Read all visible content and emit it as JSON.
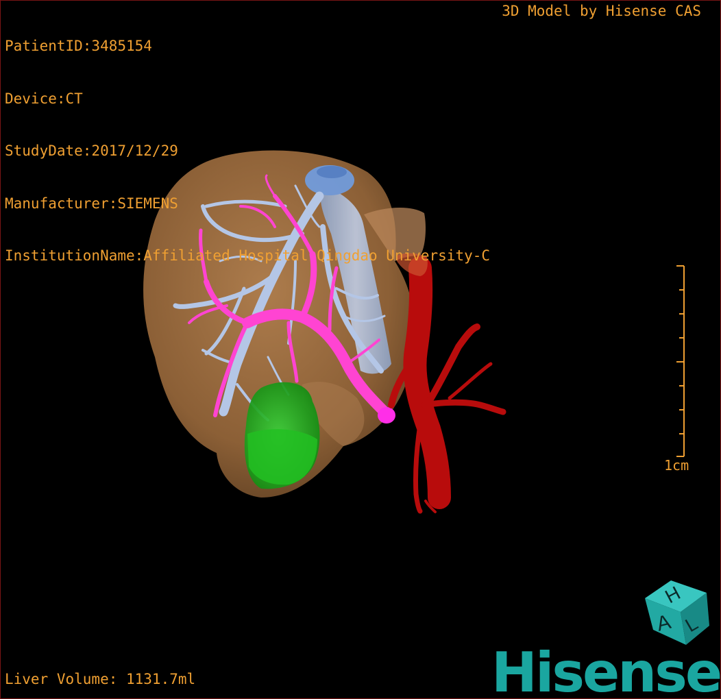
{
  "viewer": {
    "info": {
      "patient_id": "PatientID:3485154",
      "device": "Device:CT",
      "study_date": "StudyDate:2017/12/29",
      "manufacturer": "Manufacturer:SIEMENS",
      "institution": "InstitutionName:Affiliated Hospital Qingdao University-C"
    },
    "model_credit": "3D Model by Hisense CAS",
    "liver_volume": "Liver Volume: 1131.7ml",
    "scale_label": "1cm",
    "orientation_cube": {
      "top_letter": "H",
      "front_letter": "A",
      "side_letter": "L"
    },
    "brand": "Hisense"
  },
  "colors": {
    "overlay_text": "#f0a032",
    "liver": "#b07a48",
    "hepatic_vein": "#b4c6e6",
    "portal_vein": "#ff44d2",
    "artery": "#b80c0c",
    "lesion": "#1ea81e",
    "ivc_top": "#6ea2ee",
    "brand": "#1aa6a0"
  }
}
